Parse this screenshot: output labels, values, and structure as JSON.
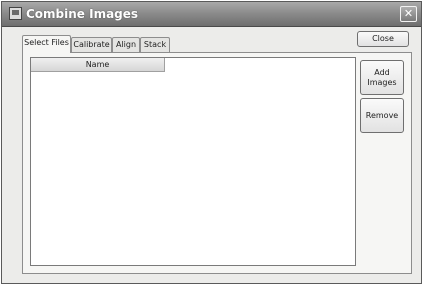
{
  "window": {
    "title": "Combine Images",
    "close_glyph": "✕"
  },
  "toolbar": {
    "close_label": "Close"
  },
  "tabs": [
    {
      "label": "Select Files",
      "active": true
    },
    {
      "label": "Calibrate",
      "active": false
    },
    {
      "label": "Align",
      "active": false
    },
    {
      "label": "Stack",
      "active": false
    }
  ],
  "file_list": {
    "columns": [
      "Name"
    ],
    "rows": []
  },
  "side_buttons": {
    "add_images_label": "Add\nImages",
    "remove_label": "Remove"
  },
  "icons": {
    "app": "image-stack-icon",
    "close": "close-icon"
  }
}
